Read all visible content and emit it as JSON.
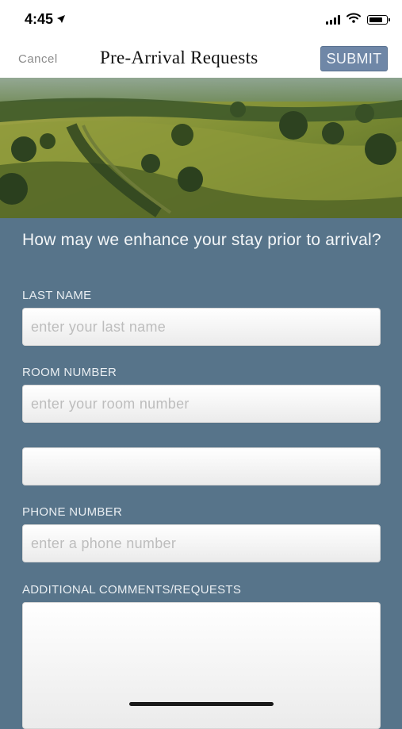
{
  "status_bar": {
    "time": "4:45",
    "location_arrow": "➤"
  },
  "nav": {
    "cancel_label": "Cancel",
    "title": "Pre-Arrival Requests",
    "submit_label": "SUBMIT"
  },
  "hero": {
    "image_desc": "aerial-countryside-photo"
  },
  "form": {
    "question": "How may we enhance your stay prior to arrival?",
    "last_name": {
      "label": "LAST NAME",
      "placeholder": "enter your last name"
    },
    "room_number": {
      "label": "ROOM NUMBER",
      "placeholder": "enter your room number"
    },
    "unlabeled_field": {
      "placeholder": ""
    },
    "phone_number": {
      "label": "PHONE NUMBER",
      "placeholder": "enter a phone number"
    },
    "comments": {
      "label": "ADDITIONAL COMMENTS/REQUESTS"
    }
  },
  "colors": {
    "form_background": "#57748a",
    "submit_button": "#6f87a7",
    "cancel_text": "#8a8a8a"
  },
  "icons": [
    "location-arrow-icon",
    "cellular-signal-icon",
    "wifi-icon",
    "battery-icon"
  ]
}
